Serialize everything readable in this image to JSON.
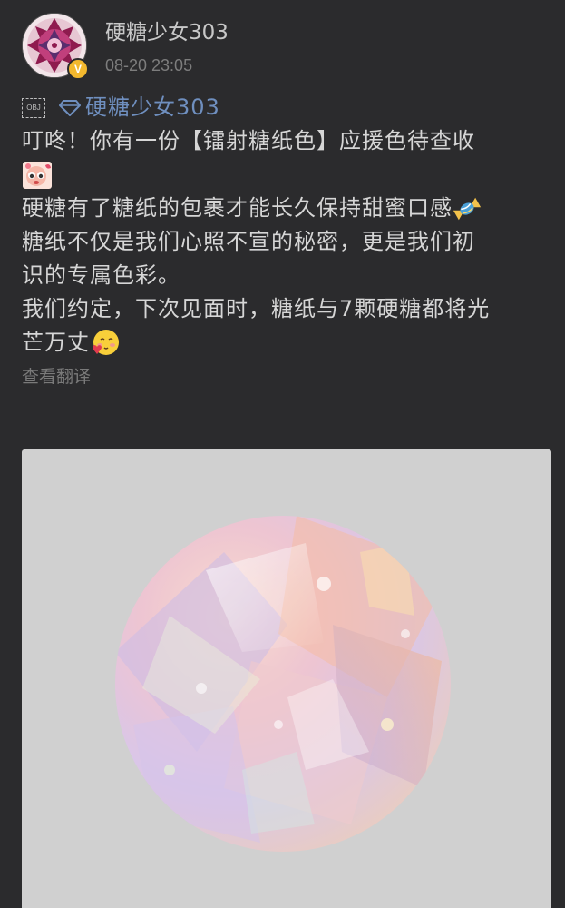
{
  "post": {
    "username": "硬糖少女303",
    "timestamp": "08-20 23:05",
    "verified_badge": "V",
    "avatar_icon": "mandala-avatar-icon",
    "object_placeholder": "OBJ",
    "mention": "硬糖少女303",
    "lines": {
      "l1": "叮咚！你有一份【镭射糖纸色】应援色待查收",
      "l2": "硬糖有了糖纸的包裹才能长久保持甜蜜口感",
      "l3a": "糖纸不仅是我们心照不宣的秘密，更是我们初",
      "l3b": "识的专属色彩。",
      "l4a": "我们约定，下次见面时，糖纸与7颗硬糖都将光",
      "l4b": "芒万丈"
    },
    "translate_link": "查看翻译",
    "image_alt": "holographic-candy-wrapper-image"
  },
  "colors": {
    "background": "#2b2b2d",
    "text": "#d6d6d6",
    "username": "#c8c8c8",
    "mention": "#6f8fbf",
    "muted": "#7a7a7a",
    "badge": "#f3b82e",
    "image_bg": "#d0d0d0"
  }
}
